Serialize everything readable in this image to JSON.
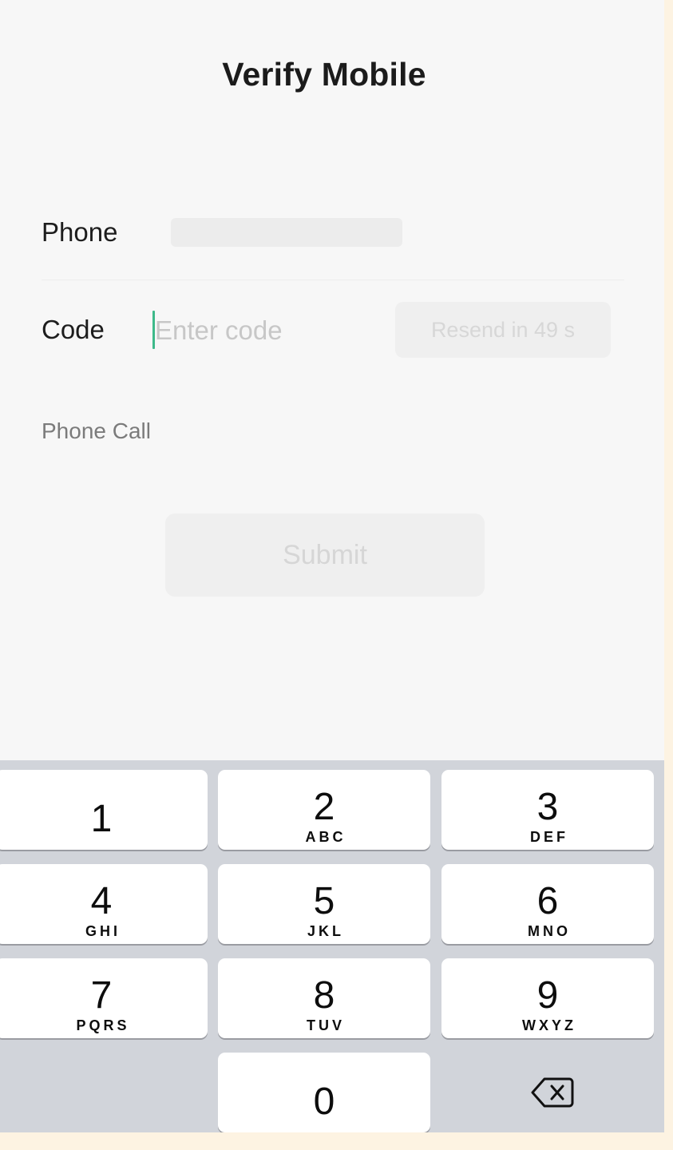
{
  "header": {
    "title": "Verify Mobile"
  },
  "form": {
    "phone_label": "Phone",
    "code_label": "Code",
    "code_placeholder": "Enter code",
    "code_value": "",
    "resend_label": "Resend in 49 s",
    "phone_call_label": "Phone Call",
    "submit_label": "Submit"
  },
  "keypad": {
    "keys": [
      {
        "digit": "1",
        "letters": ""
      },
      {
        "digit": "2",
        "letters": "ABC"
      },
      {
        "digit": "3",
        "letters": "DEF"
      },
      {
        "digit": "4",
        "letters": "GHI"
      },
      {
        "digit": "5",
        "letters": "JKL"
      },
      {
        "digit": "6",
        "letters": "MNO"
      },
      {
        "digit": "7",
        "letters": "PQRS"
      },
      {
        "digit": "8",
        "letters": "TUV"
      },
      {
        "digit": "9",
        "letters": "WXYZ"
      },
      {
        "digit": "0",
        "letters": ""
      }
    ],
    "backspace_icon": "backspace-icon"
  },
  "colors": {
    "caret": "#3db98a",
    "keypad_background": "#d1d4da",
    "disabled_button": "#efefef"
  }
}
